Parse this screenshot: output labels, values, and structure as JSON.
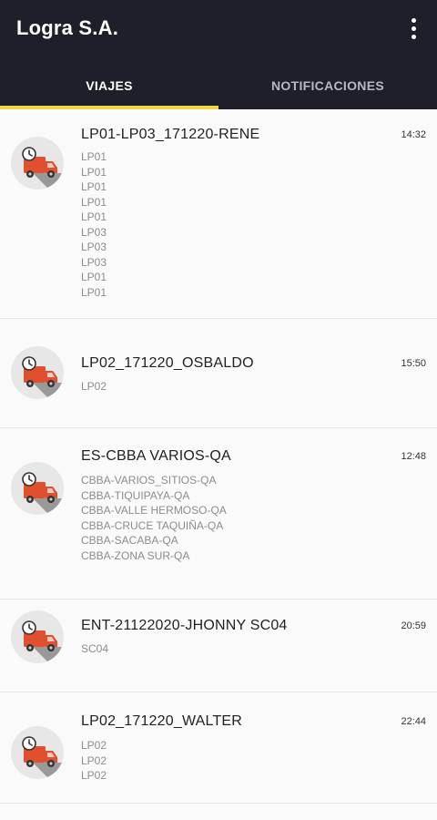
{
  "app": {
    "title": "Logra S.A."
  },
  "tabs": [
    {
      "label": "VIAJES",
      "active": true
    },
    {
      "label": "NOTIFICACIONES",
      "active": false
    }
  ],
  "colors": {
    "appbar": "#1f1f2b",
    "indicator": "#f2d541",
    "truck": "#e0502f"
  },
  "trips": [
    {
      "name": "LP01-LP03_171220-RENE",
      "time": "14:32",
      "stops": [
        "LP01",
        "LP01",
        "LP01",
        "LP01",
        "LP01",
        "LP03",
        "LP03",
        "LP03",
        "LP01",
        "LP01"
      ]
    },
    {
      "name": "LP02_171220_OSBALDO",
      "time": "15:50",
      "stops": [
        "LP02"
      ]
    },
    {
      "name": "ES-CBBA VARIOS-QA",
      "time": "12:48",
      "stops": [
        "CBBA-VARIOS_SITIOS-QA",
        "CBBA-TIQUIPAYA-QA",
        "CBBA-VALLE HERMOSO-QA",
        "CBBA-CRUCE TAQUIÑA-QA",
        "CBBA-SACABA-QA",
        "CBBA-ZONA SUR-QA"
      ]
    },
    {
      "name": "ENT-21122020-JHONNY SC04",
      "time": "20:59",
      "stops": [
        "SC04"
      ]
    },
    {
      "name": "LP02_171220_WALTER",
      "time": "22:44",
      "stops": [
        "LP02",
        "LP02",
        "LP02"
      ]
    }
  ]
}
